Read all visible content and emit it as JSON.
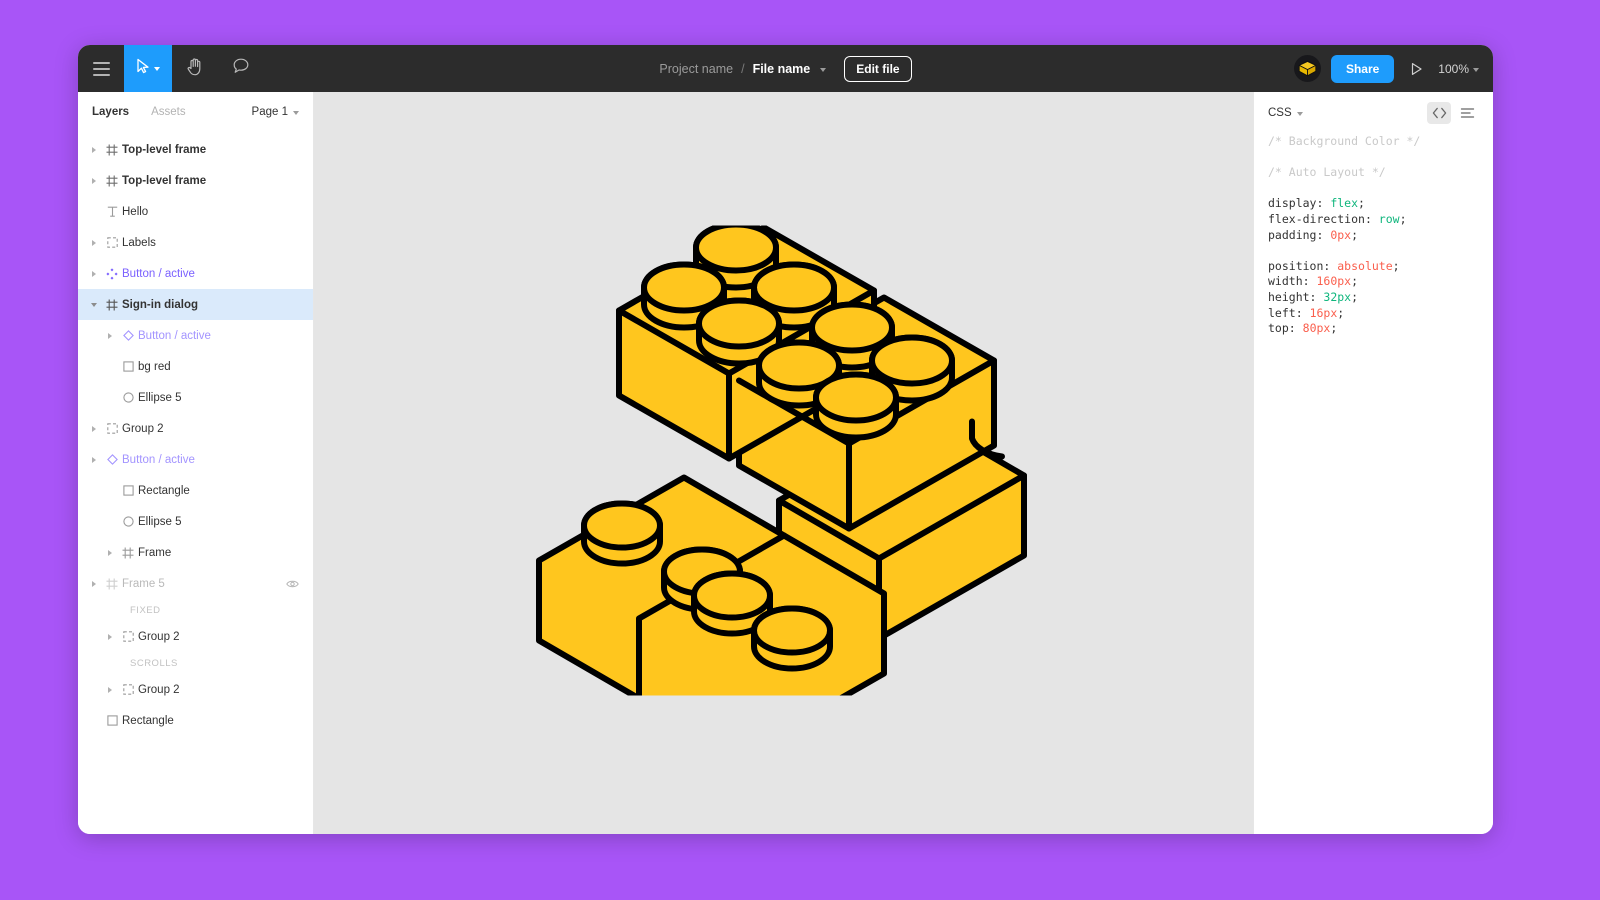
{
  "window": {
    "background_color": "#a855f7",
    "canvas_color": "#e5e5e5",
    "accent_color": "#1e9cfc",
    "selection_color": "#daeafb",
    "component_color": "#7b61ff"
  },
  "toolbar": {
    "menu_label": "main-menu",
    "tools": [
      {
        "name": "menu-icon",
        "label": "Menu"
      },
      {
        "name": "move-tool",
        "label": "Move"
      },
      {
        "name": "hand-tool",
        "label": "Hand"
      },
      {
        "name": "comment-tool",
        "label": "Comment"
      }
    ],
    "project_name": "Project name",
    "separator": "/",
    "file_name": "File name",
    "edit_file_label": "Edit file",
    "share_label": "Share",
    "zoom_level": "100%",
    "avatar_label": "lego-brick-avatar",
    "present_label": "Present"
  },
  "left_panel": {
    "tab_layers": "Layers",
    "tab_assets": "Assets",
    "page_name": "Page 1",
    "layers": [
      {
        "label": "Top-level frame",
        "icon": "frame-icon",
        "indent": 0,
        "caret": "right",
        "style": "bold"
      },
      {
        "label": "Top-level frame",
        "icon": "frame-icon",
        "indent": 0,
        "caret": "right",
        "style": "bold"
      },
      {
        "label": "Hello",
        "icon": "text-icon",
        "indent": 0,
        "caret": "none",
        "style": "normal"
      },
      {
        "label": "Labels",
        "icon": "group-icon",
        "indent": 0,
        "caret": "right",
        "style": "normal"
      },
      {
        "label": "Button / active",
        "icon": "component-set-icon",
        "indent": 0,
        "caret": "right",
        "style": "purple"
      },
      {
        "label": "Sign-in dialog",
        "icon": "frame-icon",
        "indent": 0,
        "caret": "down",
        "style": "selected"
      },
      {
        "label": "Button / active",
        "icon": "instance-icon",
        "indent": 1,
        "caret": "right",
        "style": "purple-dim"
      },
      {
        "label": "bg red",
        "icon": "rectangle-icon",
        "indent": 1,
        "caret": "none",
        "style": "normal"
      },
      {
        "label": "Ellipse 5",
        "icon": "ellipse-icon",
        "indent": 1,
        "caret": "none",
        "style": "normal"
      },
      {
        "label": "Group 2",
        "icon": "group-icon",
        "indent": 0,
        "caret": "right",
        "style": "normal"
      },
      {
        "label": "Button / active",
        "icon": "instance-icon",
        "indent": 0,
        "caret": "right",
        "style": "purple-dim"
      },
      {
        "label": "Rectangle",
        "icon": "rectangle-icon",
        "indent": 1,
        "caret": "none",
        "style": "normal"
      },
      {
        "label": "Ellipse 5",
        "icon": "ellipse-icon",
        "indent": 1,
        "caret": "none",
        "style": "normal"
      },
      {
        "label": "Frame",
        "icon": "frame-icon",
        "indent": 1,
        "caret": "right",
        "style": "normal"
      },
      {
        "label": "Frame 5",
        "icon": "frame-icon",
        "indent": 0,
        "caret": "right",
        "style": "dim",
        "eye": true
      },
      {
        "label": "FIXED",
        "type": "section",
        "indent": 1
      },
      {
        "label": "Group 2",
        "icon": "group-icon",
        "indent": 1,
        "caret": "right",
        "style": "normal"
      },
      {
        "label": "SCROLLS",
        "type": "section",
        "indent": 1
      },
      {
        "label": "Group 2",
        "icon": "group-icon",
        "indent": 1,
        "caret": "right",
        "style": "normal"
      },
      {
        "label": "Rectangle",
        "icon": "rectangle-icon",
        "indent": 0,
        "caret": "none",
        "style": "normal"
      }
    ]
  },
  "right_panel": {
    "language": "CSS",
    "code_icon": "code-brackets-icon",
    "options_icon": "list-options-icon",
    "code_lines": [
      {
        "type": "comment",
        "text": "/* Background Color */"
      },
      {
        "type": "blank"
      },
      {
        "type": "comment",
        "text": "/* Auto Layout */"
      },
      {
        "type": "blank"
      },
      {
        "type": "decl",
        "prop": "display",
        "value": "flex",
        "color": "green"
      },
      {
        "type": "decl",
        "prop": "flex-direction",
        "value": "row",
        "color": "green"
      },
      {
        "type": "decl",
        "prop": "padding",
        "value": "0px",
        "color": "red"
      },
      {
        "type": "blank"
      },
      {
        "type": "decl",
        "prop": "position",
        "value": "absolute",
        "color": "red"
      },
      {
        "type": "decl",
        "prop": "width",
        "value": "160px",
        "color": "red"
      },
      {
        "type": "decl",
        "prop": "height",
        "value": "32px",
        "color": "green"
      },
      {
        "type": "decl",
        "prop": "left",
        "value": "16px",
        "color": "red"
      },
      {
        "type": "decl",
        "prop": "top",
        "value": "80px",
        "color": "red"
      }
    ]
  },
  "canvas": {
    "artwork_name": "lego-bricks-isometric-illustration",
    "brick_color": "#FFC61E",
    "outline_color": "#000000",
    "cursor": "open-hand-pan-cursor"
  }
}
